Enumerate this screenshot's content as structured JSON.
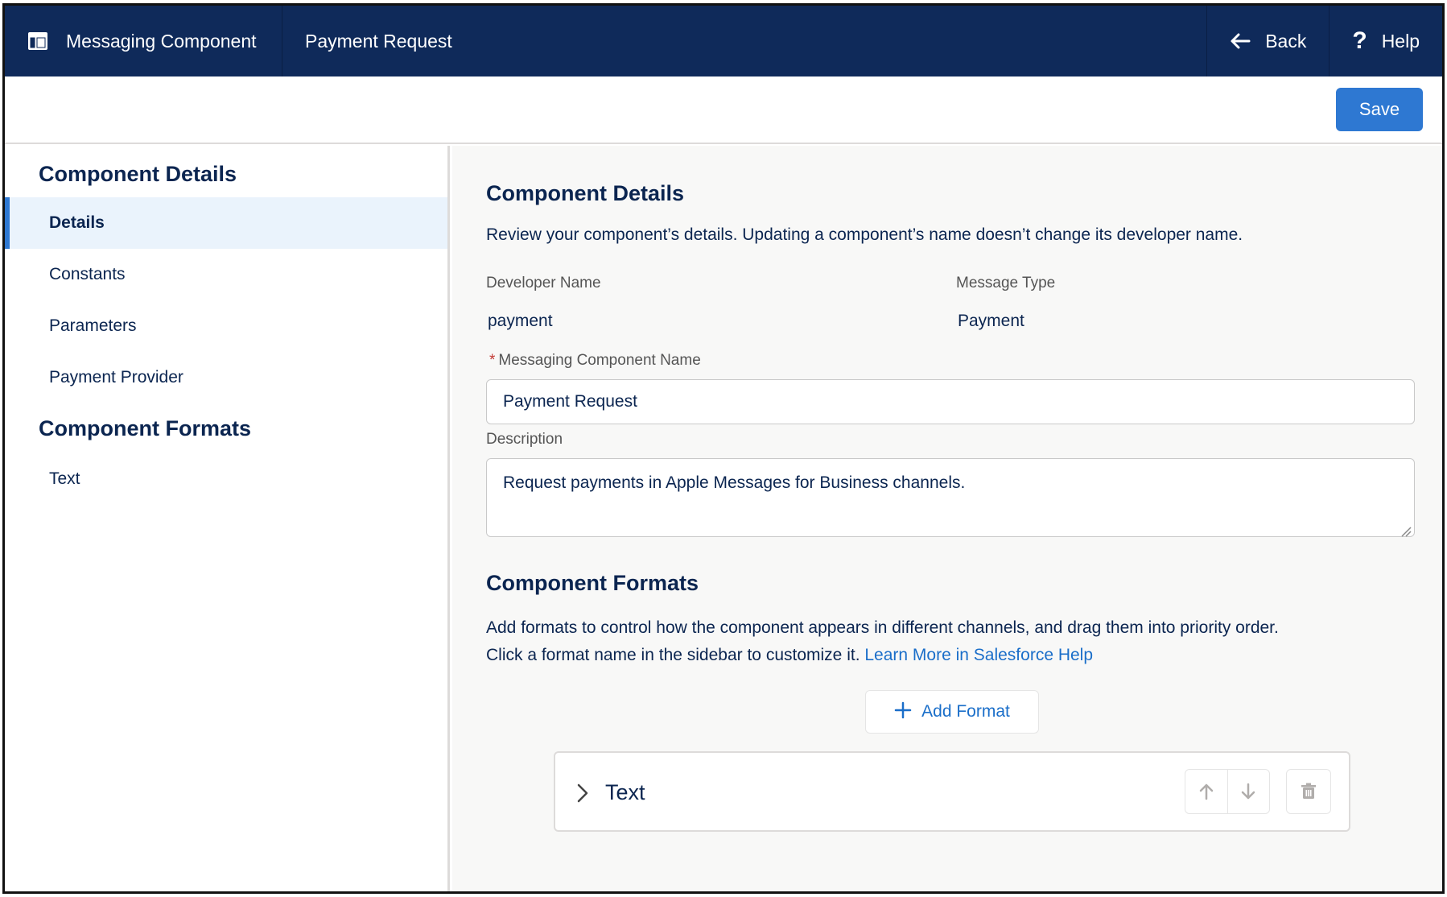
{
  "header": {
    "app_title": "Messaging Component",
    "record_title": "Payment Request",
    "back_label": "Back",
    "help_label": "Help"
  },
  "toolbar": {
    "save_label": "Save"
  },
  "sidebar": {
    "details_heading": "Component Details",
    "items": [
      {
        "label": "Details",
        "active": true
      },
      {
        "label": "Constants"
      },
      {
        "label": "Parameters"
      },
      {
        "label": "Payment Provider"
      }
    ],
    "formats_heading": "Component Formats",
    "format_items": [
      {
        "label": "Text"
      }
    ]
  },
  "main": {
    "details": {
      "title": "Component Details",
      "description": "Review your component’s details. Updating a component’s name doesn’t change its developer name.",
      "developer_name_label": "Developer Name",
      "developer_name_value": "payment",
      "message_type_label": "Message Type",
      "message_type_value": "Payment",
      "name_required_marker": "*",
      "name_label": "Messaging Component Name",
      "name_value": "Payment Request",
      "description_label": "Description",
      "description_value": "Request payments in Apple Messages for Business channels."
    },
    "formats": {
      "title": "Component Formats",
      "line1": "Add formats to control how the component appears in different channels, and drag them into priority order.",
      "line2": "Click a format name in the sidebar to customize it.",
      "link": "Learn More in Salesforce Help",
      "add_format_label": "Add Format",
      "cards": [
        {
          "label": "Text"
        }
      ]
    }
  },
  "colors": {
    "header_bg": "#0f2a5a",
    "accent": "#2e78d2",
    "active_bg": "#eaf3fc",
    "link": "#1a6ec9",
    "required": "#c23934"
  }
}
